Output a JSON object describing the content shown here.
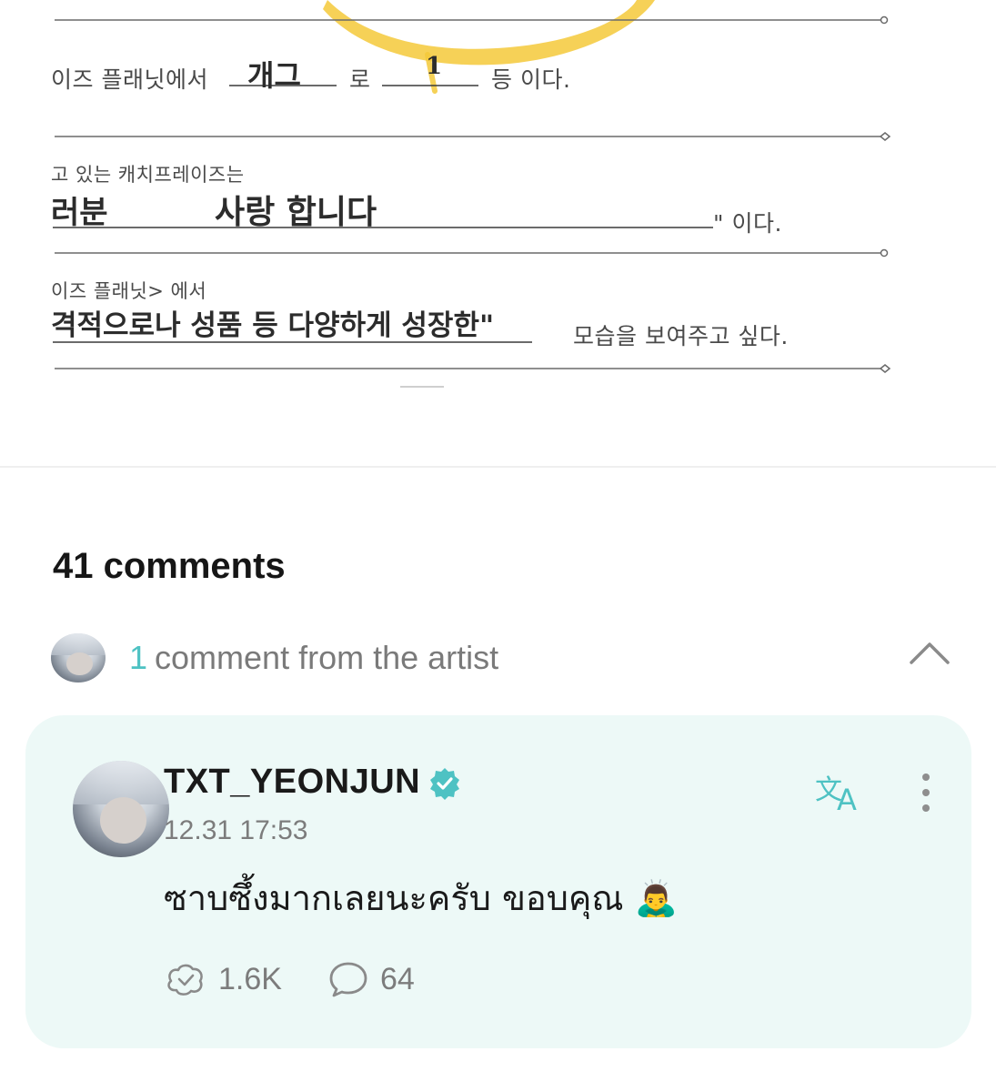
{
  "worksheet": {
    "line1": {
      "prefix": "이즈 플래닛에서",
      "answer_1": "개그",
      "middle": "로",
      "answer_2": "1",
      "suffix": "등 이다."
    },
    "line2": {
      "prompt": "고 있는 캐치프레이즈는",
      "answer_start": "러분",
      "answer": "사랑 합니다",
      "suffix": "\" 이다."
    },
    "line3": {
      "prompt": "이즈 플래닛> 에서",
      "answer": "격적으로나 성품 등 다양하게 성장한\"",
      "suffix": "모습을 보여주고 싶다."
    }
  },
  "comments": {
    "count_label": "41 comments",
    "artist_count": "1",
    "artist_label": "comment from the artist"
  },
  "comment": {
    "author": "TXT_YEONJUN",
    "timestamp": "12.31 17:53",
    "text": "ซาบซึ้งมากเลยนะครับ ขอบคุณ",
    "emoji": "🙇‍♂️",
    "likes": "1.6K",
    "replies": "64"
  },
  "colors": {
    "accent": "#4ec2c3",
    "card_bg": "#edf9f7",
    "highlight": "#f4c93a"
  },
  "icons": {
    "translate": "translate-icon",
    "more": "more-vertical-icon",
    "like": "cheer-icon",
    "reply": "speech-bubble-icon",
    "verified": "verified-badge-icon",
    "collapse": "chevron-up-icon"
  }
}
